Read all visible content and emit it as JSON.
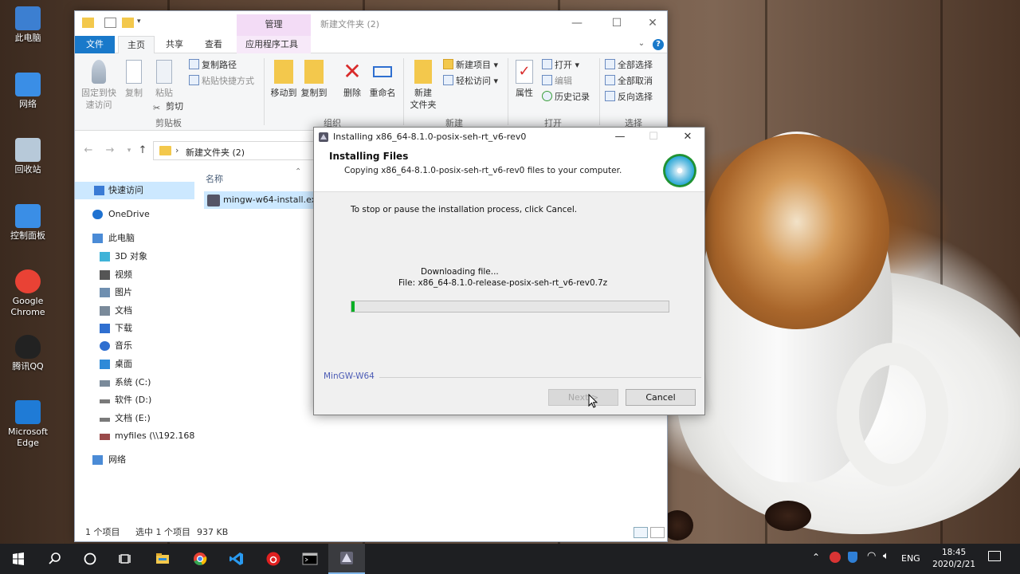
{
  "desktop": {
    "icons": [
      {
        "label": "此电脑",
        "color": "#3c7fd1"
      },
      {
        "label": "网络",
        "color": "#3a8ee6"
      },
      {
        "label": "回收站",
        "color": "#b7c9d9"
      },
      {
        "label": "控制面板",
        "color": "#3a8ee6"
      },
      {
        "label": "Google Chrome",
        "color": "#e94235"
      },
      {
        "label": "腾讯QQ",
        "color": "#222222"
      },
      {
        "label": "Microsoft Edge",
        "color": "#1f7bd6"
      }
    ]
  },
  "explorer": {
    "context_tab": "管理",
    "title": "新建文件夹 (2)",
    "tabs": [
      "文件",
      "主页",
      "共享",
      "查看",
      "应用程序工具"
    ],
    "ribbon": {
      "clipboard": {
        "pin_label_1": "固定到快",
        "pin_label_2": "速访问",
        "copy": "复制",
        "paste": "粘贴",
        "copy_path": "复制路径",
        "paste_shortcut": "粘贴快捷方式",
        "cut": "剪切",
        "group": "剪贴板"
      },
      "organize": {
        "move_to": "移动到",
        "copy_to": "复制到",
        "delete": "删除",
        "rename": "重命名",
        "group": "组织"
      },
      "new": {
        "new_folder_1": "新建",
        "new_folder_2": "文件夹",
        "new_item": "新建项目",
        "easy_access": "轻松访问",
        "group": "新建"
      },
      "open": {
        "properties": "属性",
        "open": "打开",
        "edit": "编辑",
        "history": "历史记录",
        "group": "打开"
      },
      "select": {
        "select_all": "全部选择",
        "select_none": "全部取消",
        "invert": "反向选择",
        "group": "选择"
      }
    },
    "address": {
      "crumb": "新建文件夹 (2)"
    },
    "nav": [
      {
        "label": "快速访问",
        "color": "#3a7bd5"
      },
      {
        "label": "OneDrive",
        "color": "#1f72d1"
      },
      {
        "label": "此电脑",
        "color": "#4b8bd6"
      },
      {
        "label": "3D 对象",
        "color": "#3fb3d8"
      },
      {
        "label": "视频",
        "color": "#555555"
      },
      {
        "label": "图片",
        "color": "#6f8fb0"
      },
      {
        "label": "文档",
        "color": "#7a8a9a"
      },
      {
        "label": "下载",
        "color": "#2f6fd0"
      },
      {
        "label": "音乐",
        "color": "#2f6fd0"
      },
      {
        "label": "桌面",
        "color": "#2f8ad8"
      },
      {
        "label": "系统 (C:)",
        "color": "#7a8a9a"
      },
      {
        "label": "软件 (D:)",
        "color": "#7a7a7a"
      },
      {
        "label": "文档 (E:)",
        "color": "#7a7a7a"
      },
      {
        "label": "myfiles (\\\\192.168",
        "color": "#9a4a4a"
      },
      {
        "label": "网络",
        "color": "#4b8bd6"
      }
    ],
    "column_name": "名称",
    "file": "mingw-w64-install.exe",
    "status": {
      "items": "1 个项目",
      "selected": "选中 1 个项目",
      "size": "937 KB"
    }
  },
  "installer": {
    "title": "Installing x86_64-8.1.0-posix-seh-rt_v6-rev0",
    "heading": "Installing Files",
    "subheading": "Copying x86_64-8.1.0-posix-seh-rt_v6-rev0 files to your computer.",
    "instruction": "To stop or pause the installation process, click Cancel.",
    "status": "Downloading file...",
    "file_line": "File:  x86_64-8.1.0-release-posix-seh-rt_v6-rev0.7z",
    "progress": 0.01,
    "brand": "MinGW-W64",
    "next_label": "Next >",
    "cancel_label": "Cancel"
  },
  "taskbar": {
    "language": "ENG",
    "time": "18:45",
    "date": "2020/2/21"
  }
}
